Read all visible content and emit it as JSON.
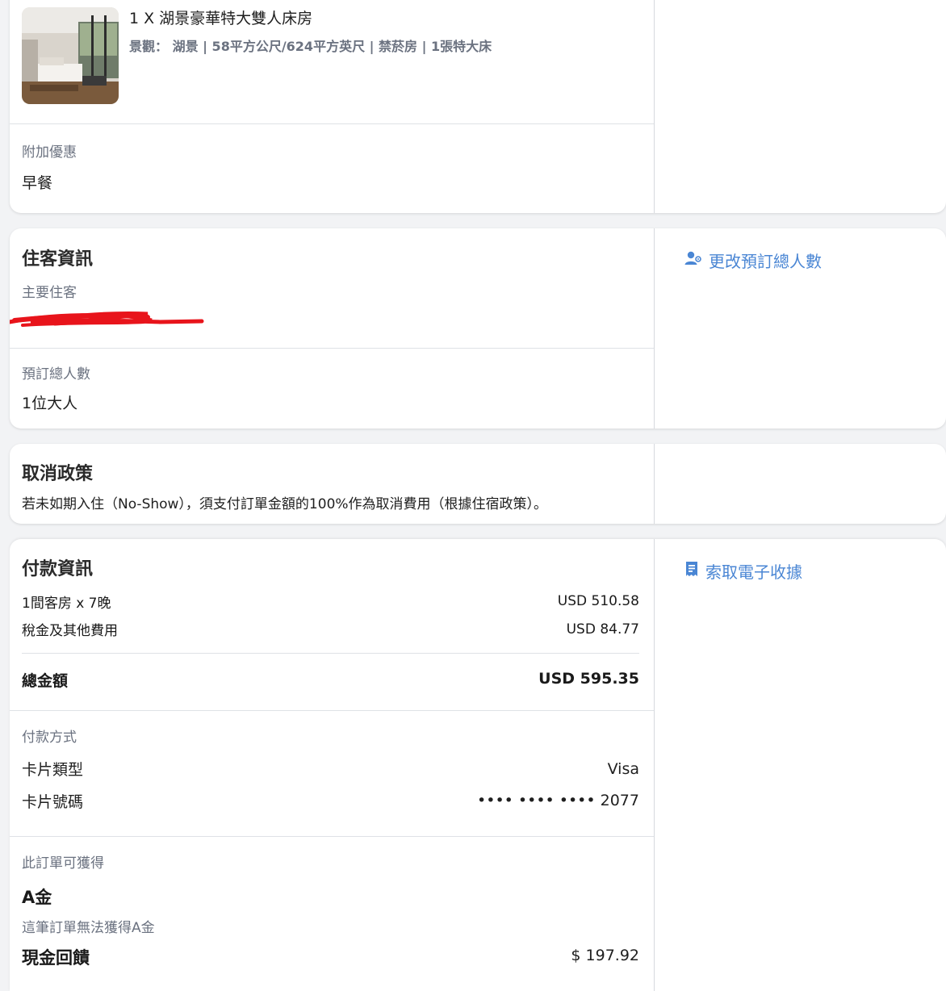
{
  "room": {
    "title": "1 X 湖景豪華特大雙人床房",
    "details": "景觀： 湖景 | 58平方公尺/624平方英尺 | 禁菸房 | 1張特大床",
    "addon_label": "附加優惠",
    "addon_value": "早餐"
  },
  "guest": {
    "section_title": "住客資訊",
    "main_guest_label": "主要住客",
    "total_label": "預訂總人數",
    "total_value": "1位大人",
    "change_link": "更改預訂總人數"
  },
  "cancellation": {
    "section_title": "取消政策",
    "text": "若未如期入住（No-Show），須支付訂單金額的100%作為取消費用（根據住宿政策）。"
  },
  "payment": {
    "section_title": "付款資訊",
    "receipt_link": "索取電子收據",
    "lines": [
      {
        "label": "1間客房 x 7晚",
        "value": "USD 510.58"
      },
      {
        "label": "稅金及其他費用",
        "value": "USD 84.77"
      }
    ],
    "total_label": "總金額",
    "total_value": "USD 595.35",
    "method_label": "付款方式",
    "card_type_label": "卡片類型",
    "card_type_value": "Visa",
    "card_number_label": "卡片號碼",
    "card_number_value": "•••• •••• •••• 2077"
  },
  "rewards": {
    "label": "此訂單可獲得",
    "a_title": "A金",
    "a_note": "這筆訂單無法獲得A金",
    "cashback_title": "現金回饋",
    "cashback_value": "$ 197.92"
  },
  "colors": {
    "link": "#4a86d4",
    "redaction": "#e8141b"
  }
}
